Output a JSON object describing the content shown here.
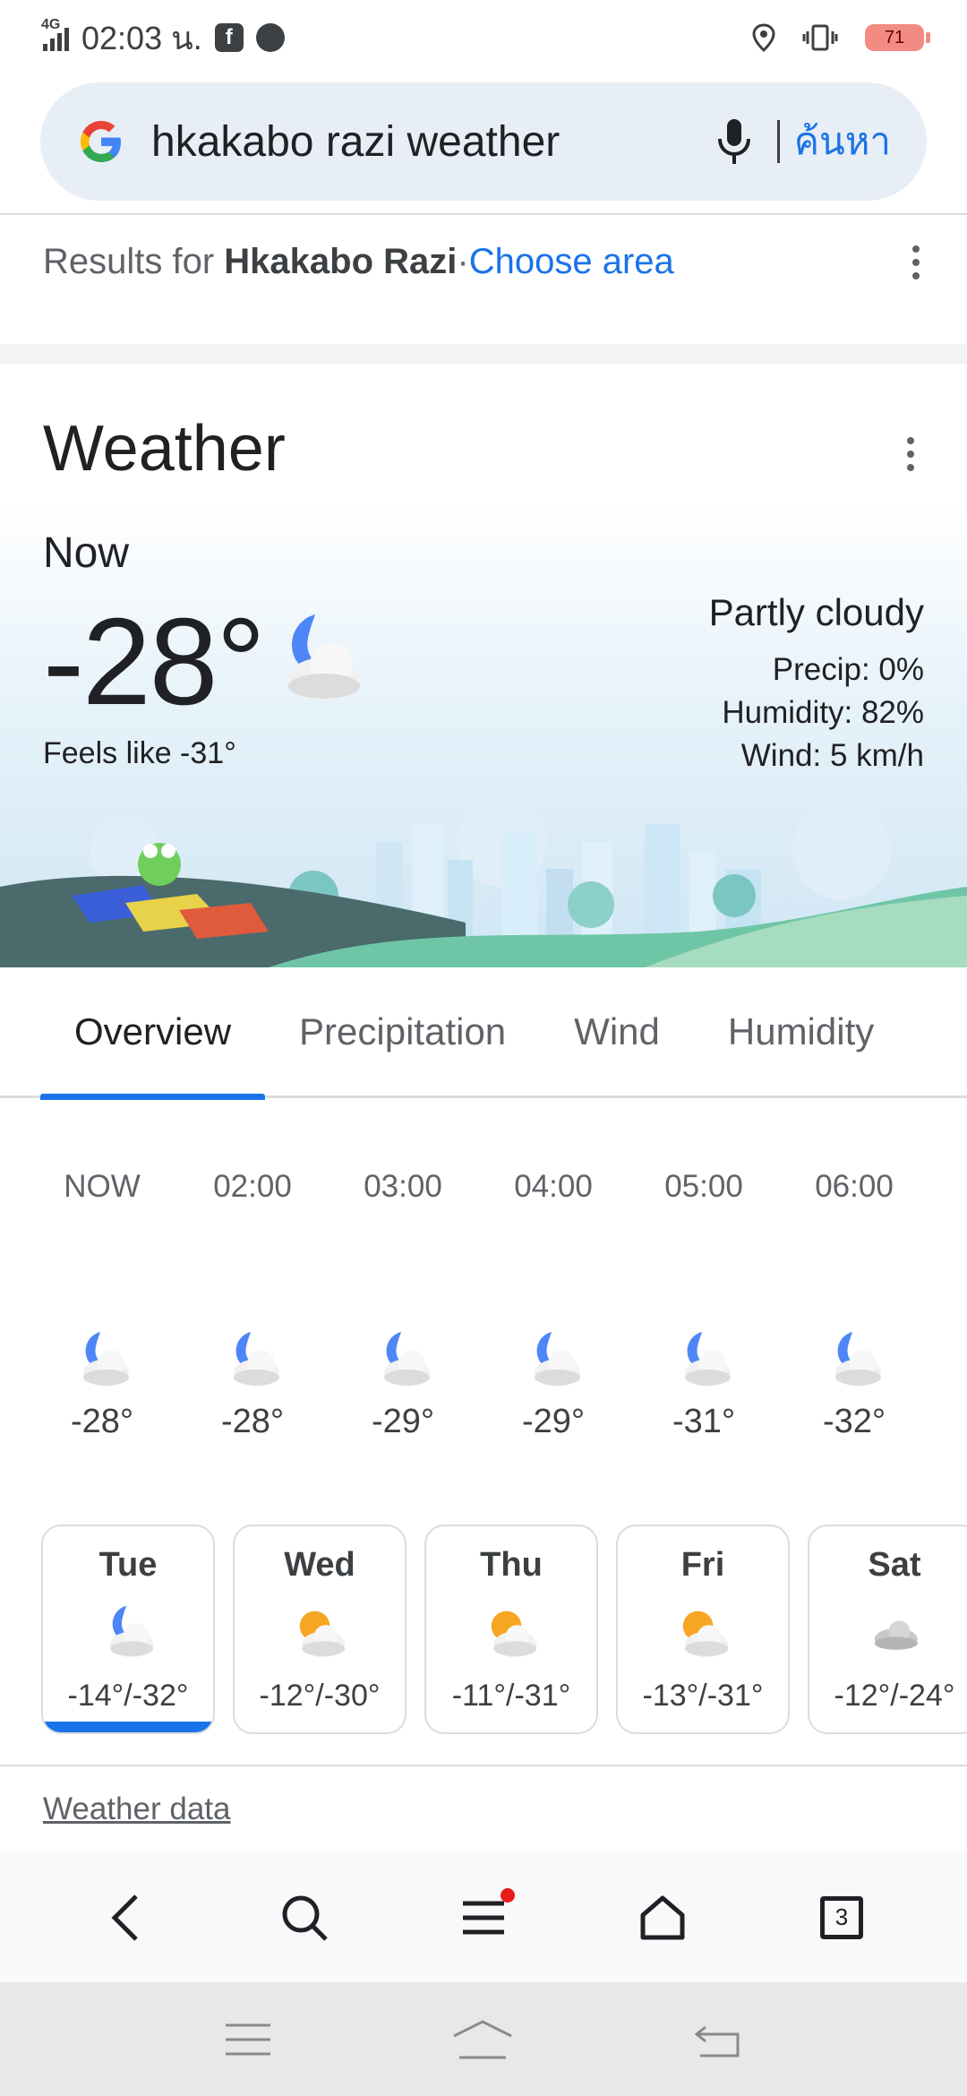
{
  "status_bar": {
    "network": "4G",
    "time": "02:03 น.",
    "battery": "71"
  },
  "search": {
    "query": "hkakabo razi weather",
    "button_label": "ค้นหา",
    "logo": "G"
  },
  "results": {
    "prefix": "Results for",
    "place": "Hkakabo Razi",
    "separator": " · ",
    "choose_area": "Choose area"
  },
  "weather": {
    "title": "Weather",
    "now_label": "Now",
    "temperature": "-28°",
    "feels_like": "Feels like -31°",
    "condition": "Partly cloudy",
    "precip": "Precip: 0%",
    "humidity": "Humidity: 82%",
    "wind": "Wind: 5 km/h",
    "tabs": [
      "Overview",
      "Precipitation",
      "Wind",
      "Humidity"
    ],
    "hourly": [
      {
        "time": "NOW",
        "temp": "-28°",
        "icon": "partly-cloudy-night-icon"
      },
      {
        "time": "02:00",
        "temp": "-28°",
        "icon": "partly-cloudy-night-icon"
      },
      {
        "time": "03:00",
        "temp": "-29°",
        "icon": "partly-cloudy-night-icon"
      },
      {
        "time": "04:00",
        "temp": "-29°",
        "icon": "partly-cloudy-night-icon"
      },
      {
        "time": "05:00",
        "temp": "-31°",
        "icon": "partly-cloudy-night-icon"
      },
      {
        "time": "06:00",
        "temp": "-32°",
        "icon": "partly-cloudy-night-icon"
      }
    ],
    "daily": [
      {
        "day": "Tue",
        "temps": "-14°/-32°",
        "icon": "partly-cloudy-night-icon"
      },
      {
        "day": "Wed",
        "temps": "-12°/-30°",
        "icon": "partly-sunny-icon"
      },
      {
        "day": "Thu",
        "temps": "-11°/-31°",
        "icon": "partly-sunny-icon"
      },
      {
        "day": "Fri",
        "temps": "-13°/-31°",
        "icon": "partly-sunny-icon"
      },
      {
        "day": "Sat",
        "temps": "-12°/-24°",
        "icon": "cloudy-icon"
      }
    ],
    "footer_link": "Weather data"
  },
  "browser_bar": {
    "tab_count": "3"
  },
  "colors": {
    "accent": "#1a73e8",
    "search_bg": "#e8eef6",
    "notification_dot": "#ea1b1b"
  }
}
